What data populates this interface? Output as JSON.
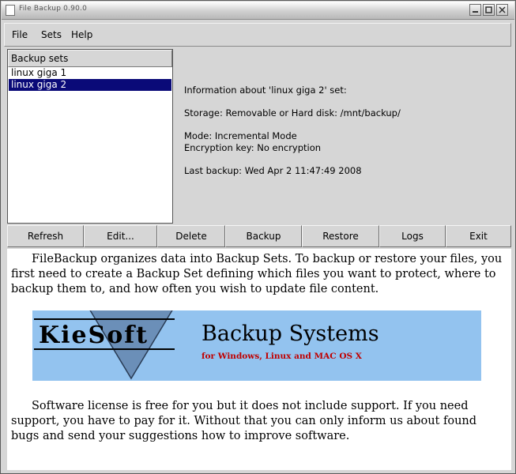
{
  "window": {
    "title": "File Backup 0.90.0"
  },
  "menu": [
    "File",
    "Sets",
    "Help"
  ],
  "backup_sets": {
    "header": "Backup sets",
    "items": [
      {
        "label": "linux giga 1",
        "selected": false
      },
      {
        "label": "linux giga 2",
        "selected": true
      }
    ]
  },
  "info": {
    "heading": "Information about 'linux giga 2' set:",
    "storage": "Storage: Removable or Hard disk: /mnt/backup/",
    "mode": "Mode: Incremental Mode",
    "encryption": "Encryption key: No encryption",
    "last_backup": "Last backup: Wed Apr 2 11:47:49 2008"
  },
  "buttons": [
    "Refresh",
    "Edit...",
    "Delete",
    "Backup",
    "Restore",
    "Logs",
    "Exit"
  ],
  "description": {
    "intro": "FileBackup organizes data into Backup Sets. To backup or restore your files, you first need to create a Backup Set defining which files you want to protect, where to backup them to, and how often you wish to update file content.",
    "license": "Software license is free for you but it does not include support. If you need support, you have to pay for it. Without that you can only inform us about found bugs and send your suggestions how to improve software."
  },
  "banner": {
    "logo": "KieSoft",
    "title": "Backup Systems",
    "subtitle": "for Windows, Linux and MAC OS X"
  },
  "colors": {
    "selection": "#0a0a78",
    "banner_bg": "#93c3ef",
    "banner_subtitle": "#c00000"
  },
  "icons": [
    "window-menu-icon",
    "minimize-icon",
    "maximize-icon",
    "close-icon"
  ]
}
